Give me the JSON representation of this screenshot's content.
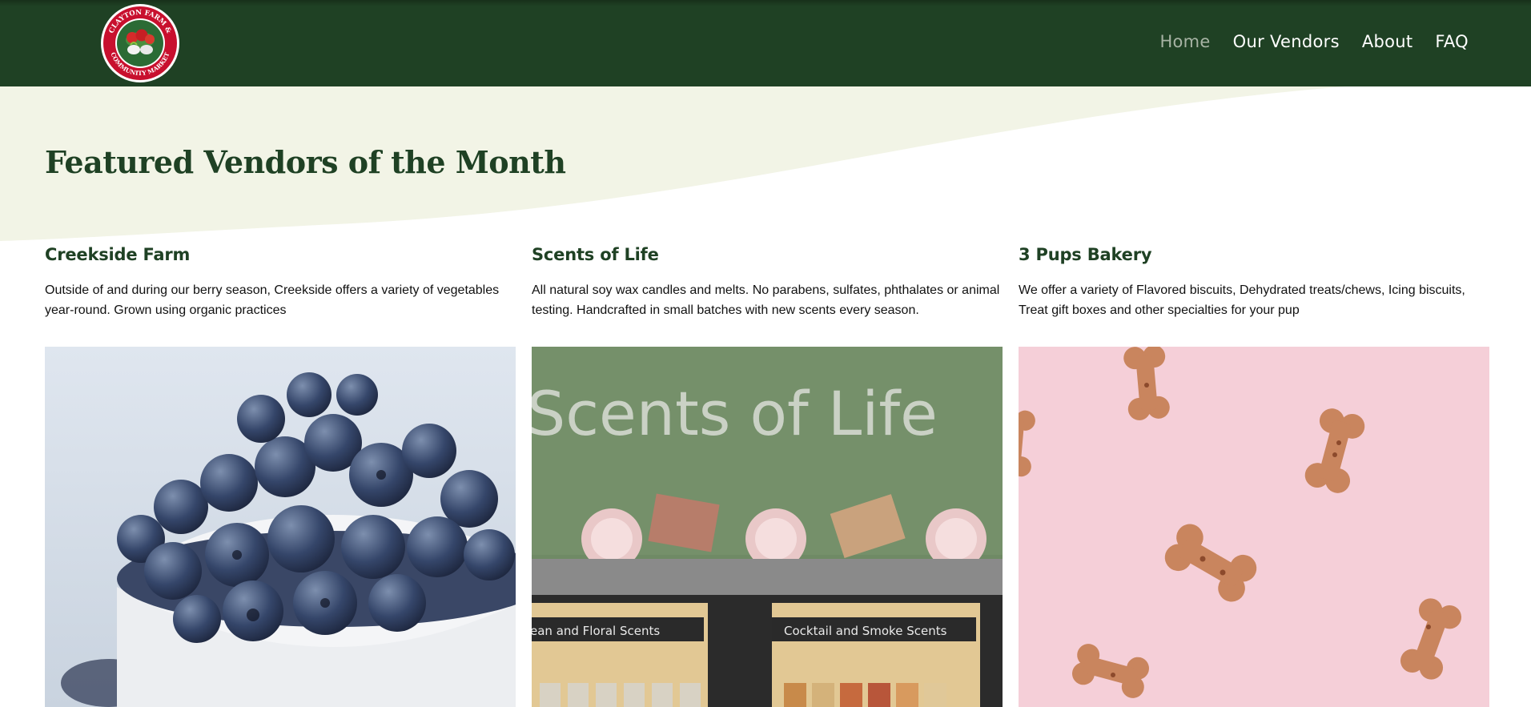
{
  "header": {
    "logo_text_top": "CLAYTON FARM &",
    "logo_text_bottom": "COMMUNITY MARKET",
    "nav": [
      {
        "label": "Home",
        "active": true
      },
      {
        "label": "Our Vendors",
        "active": false
      },
      {
        "label": "About",
        "active": false
      },
      {
        "label": "FAQ",
        "active": false
      }
    ]
  },
  "page_title": "Featured Vendors of the Month",
  "vendors": [
    {
      "name": "Creekside Farm",
      "description": "Outside of and during our berry season, Creekside offers a variety of vegetables year-round. Grown using organic practices"
    },
    {
      "name": "Scents of Life",
      "description": "All natural soy wax candles and melts. No parabens, sulfates, phthalates or animal testing. Handcrafted in small batches with new scents every season.",
      "photo_banner": "Scents of Life",
      "photo_sign_left": "ean and Floral Scents",
      "photo_sign_right": "Cocktail and Smoke Scents"
    },
    {
      "name": "3 Pups Bakery",
      "description": "We offer a variety of Flavored biscuits, Dehydrated treats/chews, Icing biscuits, Treat gift boxes and other specialties for your pup"
    }
  ],
  "colors": {
    "header_bg": "#1f4124",
    "wave": "#f2f4e6",
    "title": "#1f4124",
    "logo_red": "#c8102e"
  }
}
